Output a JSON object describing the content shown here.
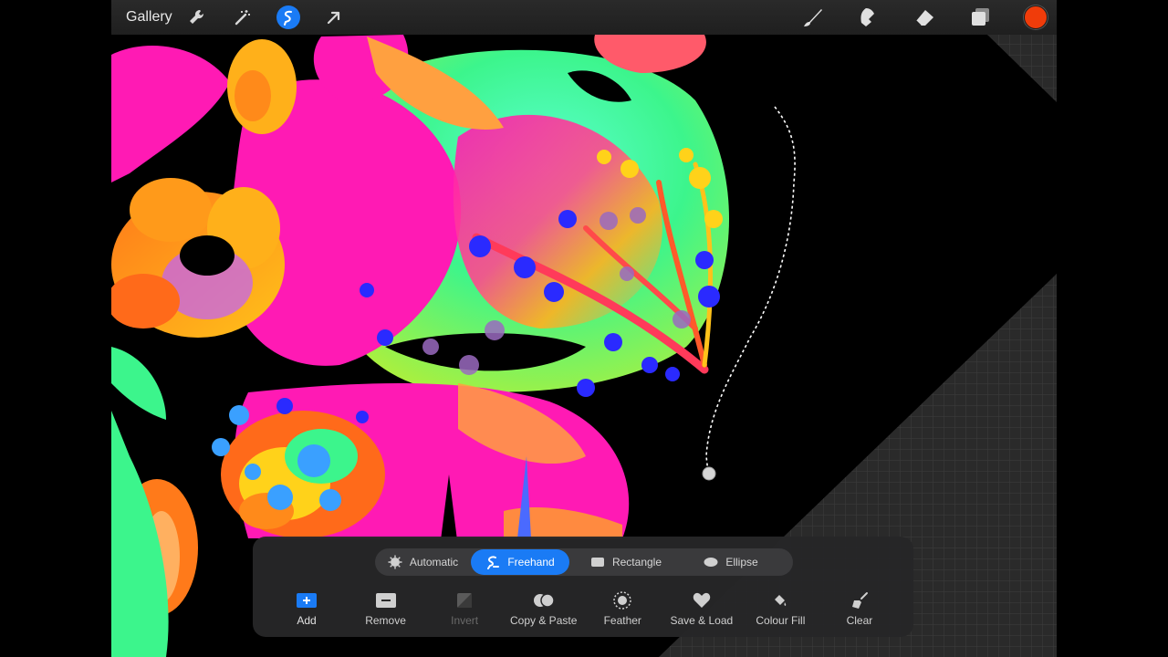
{
  "toolbar": {
    "gallery_label": "Gallery",
    "left_icons": [
      "wrench-icon",
      "magic-wand-icon",
      "selection-icon",
      "transform-arrow-icon"
    ],
    "right_icons": [
      "brush-icon",
      "smudge-icon",
      "eraser-icon",
      "layers-icon"
    ],
    "active_color": "#f03c0a"
  },
  "selection": {
    "modes": [
      {
        "label": "Automatic",
        "icon": "automatic-icon"
      },
      {
        "label": "Freehand",
        "icon": "freehand-icon",
        "active": true
      },
      {
        "label": "Rectangle",
        "icon": "rectangle-icon"
      },
      {
        "label": "Ellipse",
        "icon": "ellipse-icon"
      }
    ],
    "actions": [
      {
        "label": "Add",
        "icon": "add-icon"
      },
      {
        "label": "Remove",
        "icon": "remove-icon"
      },
      {
        "label": "Invert",
        "icon": "invert-icon",
        "disabled": true
      },
      {
        "label": "Copy & Paste",
        "icon": "copy-paste-icon"
      },
      {
        "label": "Feather",
        "icon": "feather-icon"
      },
      {
        "label": "Save & Load",
        "icon": "save-load-icon"
      },
      {
        "label": "Colour Fill",
        "icon": "colour-fill-icon"
      },
      {
        "label": "Clear",
        "icon": "clear-icon"
      }
    ]
  },
  "colors": {
    "accent": "#1a7bf5",
    "magenta": "#ff1aa8",
    "green": "#3cf5a0",
    "orange": "#ff8a1a",
    "yellow": "#ffd21a",
    "blue": "#2a2aff"
  }
}
